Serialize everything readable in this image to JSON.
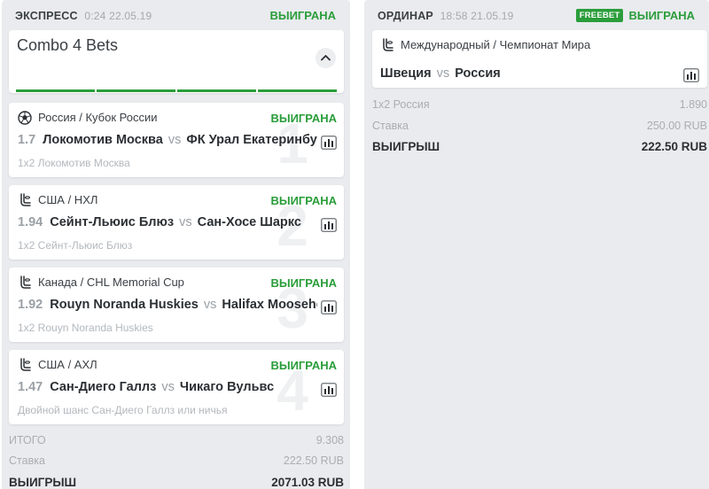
{
  "express": {
    "type": "ЭКСПРЕСС",
    "time": "0:24 22.05.19",
    "status": "ВЫИГРАНА",
    "combo_title": "Combo 4 Bets",
    "events": [
      {
        "icon": "soccer-ball-icon",
        "league": "Россия / Кубок России",
        "status": "ВЫИГРАНА",
        "odd": "1.7",
        "home": "Локомотив Москва",
        "vs": "vs",
        "away": "ФК Урал Екатеринбург",
        "pick": "1x2 Локомотив Москва",
        "number": "1"
      },
      {
        "icon": "hockey-stick-icon",
        "league": "США / НХЛ",
        "status": "ВЫИГРАНА",
        "odd": "1.94",
        "home": "Сейнт-Льюис Блюз",
        "vs": "vs",
        "away": "Сан-Хосе Шаркс",
        "pick": "1x2 Сейнт-Льюис Блюз",
        "number": "2"
      },
      {
        "icon": "hockey-stick-icon",
        "league": "Канада / CHL Memorial Cup",
        "status": "ВЫИГРАНА",
        "odd": "1.92",
        "home": "Rouyn Noranda Huskies",
        "vs": "vs",
        "away": "Halifax Mooseheads",
        "pick": "1x2 Rouyn Noranda Huskies",
        "number": "3"
      },
      {
        "icon": "hockey-stick-icon",
        "league": "США / АХЛ",
        "status": "ВЫИГРАНА",
        "odd": "1.47",
        "home": "Сан-Диего Галлз",
        "vs": "vs",
        "away": "Чикаго Вульвс",
        "pick": "Двойной шанс Сан-Диего Галлз или ничья",
        "number": "4"
      }
    ],
    "totals": {
      "total_label": "ИТОГО",
      "total_value": "9.308",
      "stake_label": "Ставка",
      "stake_value": "222.50 RUB",
      "win_label": "ВЫИГРЫШ",
      "win_value": "2071.03 RUB"
    }
  },
  "single": {
    "type": "ОРДИНАР",
    "time": "18:58 21.05.19",
    "badge": "FREEBET",
    "status": "ВЫИГРАНА",
    "league": "Международный / Чемпионат Мира",
    "home": "Швеция",
    "vs": "vs",
    "away": "Россия",
    "totals": {
      "pick_label": "1x2 Россия",
      "pick_value": "1.890",
      "stake_label": "Ставка",
      "stake_value": "250.00 RUB",
      "win_label": "ВЫИГРЫШ",
      "win_value": "222.50 RUB"
    }
  },
  "colors": {
    "win_green": "#2a9d3a",
    "panel_bg": "#e9ebee",
    "muted": "#a9aeb3"
  }
}
